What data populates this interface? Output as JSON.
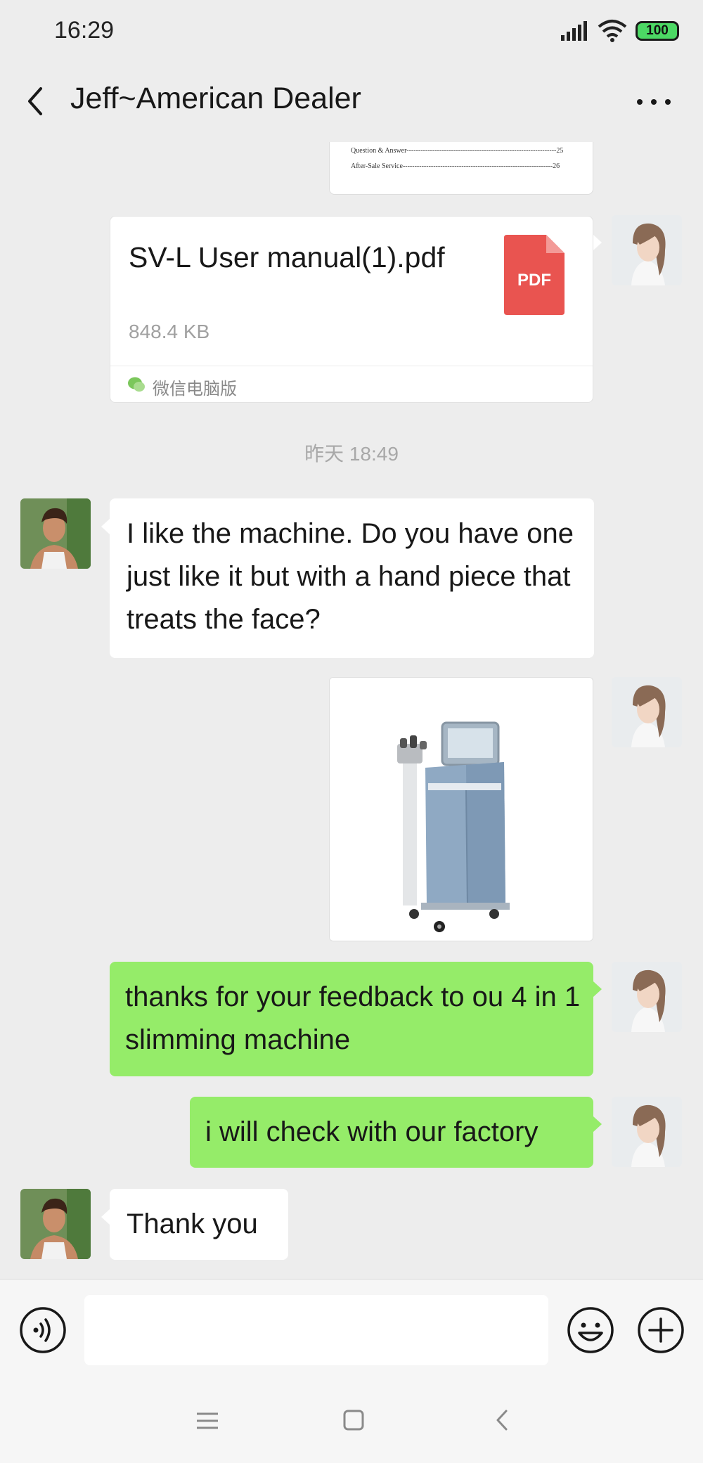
{
  "status_bar": {
    "time": "16:29",
    "battery": "100",
    "battery_color": "#4cd964"
  },
  "header": {
    "title": "Jeff~American Dealer",
    "back_icon": "chevron-left-icon",
    "more_icon": "more-dots-icon"
  },
  "document_preview": {
    "lines": [
      {
        "label": "Question & Answer",
        "page": "25"
      },
      {
        "label": "After-Sale Service",
        "page": "26"
      }
    ]
  },
  "file_message": {
    "name": "SV-L User manual(1).pdf",
    "size": "848.4 KB",
    "icon_label": "PDF",
    "source": "微信电脑版",
    "icon_color": "#e95450"
  },
  "timestamp": "昨天 18:49",
  "messages": [
    {
      "from": "Jeff",
      "text": "I like the machine.  Do you have one just like it but with a hand piece that treats the face?"
    },
    {
      "from": "me",
      "type": "image"
    },
    {
      "from": "me",
      "text": "thanks for your feedback to ou 4 in 1 slimming machine"
    },
    {
      "from": "me",
      "text": "i will check with our factory"
    },
    {
      "from": "Jeff",
      "text": "Thank you"
    }
  ],
  "colors": {
    "background": "#ededed",
    "bubble_green": "#95ec69",
    "bubble_white": "#ffffff"
  },
  "input_bar": {
    "placeholder": "",
    "voice_icon": "voice-icon",
    "emoji_icon": "emoji-icon",
    "plus_icon": "plus-icon"
  },
  "nav_bar": {
    "icons": [
      "menu-icon",
      "home-icon",
      "back-icon"
    ]
  }
}
